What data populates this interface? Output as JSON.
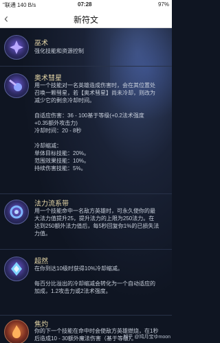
{
  "status": {
    "left": "\"联通 140 B/s",
    "time": "07:28",
    "right": "97%"
  },
  "nav": {
    "title": "新符文"
  },
  "runes": [
    {
      "name": "巫术",
      "lines": [
        "强化技能和资源控制"
      ]
    },
    {
      "name": "奥术彗星",
      "lines": [
        "用一个技能对一名英雄造成伤害时，会在其位置处",
        "召唤一颗彗星，若【奥术彗星】尚未冷却，则改为",
        "减少它的剩余冷却时间。",
        "",
        "自适应伤害：36 - 100基于等级(+0.2法术强度",
        "+0.35额外攻击力)",
        "冷却时间：20 - 8秒",
        "",
        "冷却缩减：",
        "单体目标技能：20%。",
        "范围效果技能：10%。",
        "持续伤害技能：5%。"
      ]
    },
    {
      "name": "法力流系带",
      "lines": [
        "用一个技能命中一名敌方英雄时，可永久使你的最",
        "大法力值提升25，提升法力的上限为250法力。在",
        "达到250额外法力值后，每5秒回复你1%的已损失法",
        "力值。"
      ]
    },
    {
      "name": "超然",
      "lines": [
        "在你到达10级时获得10%冷却缩减。",
        "",
        "每百分比溢出的冷却缩减会转化为一个自动适应的",
        "加成，1.2攻击力或2法术强度。"
      ]
    },
    {
      "name": "焦灼",
      "lines": [
        "你的下一个技能在命中时会使敌方英雄燃烧，在1秒",
        "后造成10 - 30额外魔法伤害（基于等级）。"
      ]
    }
  ],
  "watermark": "知乎 @鸠月宝ゆmoon"
}
